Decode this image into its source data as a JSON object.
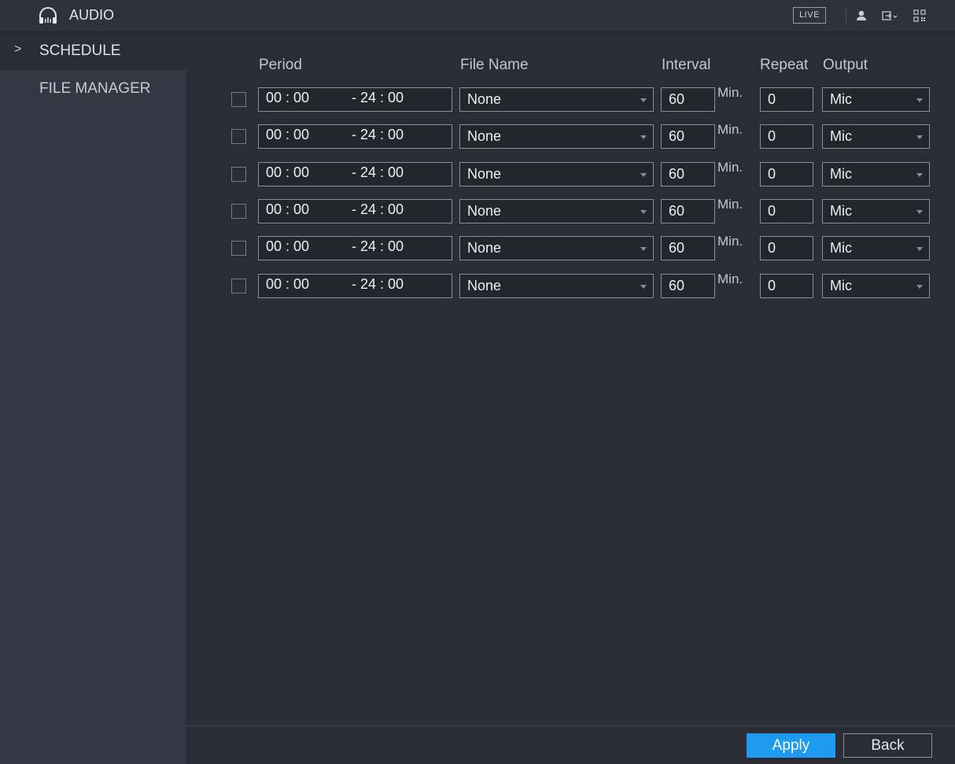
{
  "header": {
    "title": "AUDIO",
    "app_icon": "headphones-icon",
    "live_label": "LIVE",
    "icons": [
      "user-icon",
      "logout-icon",
      "qr-code-icon"
    ]
  },
  "sidebar": {
    "items": [
      {
        "label": "SCHEDULE",
        "active": true
      },
      {
        "label": "FILE MANAGER",
        "active": false
      }
    ]
  },
  "table": {
    "headers": {
      "period": "Period",
      "file_name": "File Name",
      "interval": "Interval",
      "repeat": "Repeat",
      "output": "Output"
    },
    "rows": [
      {
        "checked": false,
        "start": "00 : 00",
        "end": "- 24 : 00",
        "file": "None",
        "interval": "60",
        "unit": "Min.",
        "repeat": "0",
        "output": "Mic"
      },
      {
        "checked": false,
        "start": "00 : 00",
        "end": "- 24 : 00",
        "file": "None",
        "interval": "60",
        "unit": "Min.",
        "repeat": "0",
        "output": "Mic"
      },
      {
        "checked": false,
        "start": "00 : 00",
        "end": "- 24 : 00",
        "file": "None",
        "interval": "60",
        "unit": "Min.",
        "repeat": "0",
        "output": "Mic"
      },
      {
        "checked": false,
        "start": "00 : 00",
        "end": "- 24 : 00",
        "file": "None",
        "interval": "60",
        "unit": "Min.",
        "repeat": "0",
        "output": "Mic"
      },
      {
        "checked": false,
        "start": "00 : 00",
        "end": "- 24 : 00",
        "file": "None",
        "interval": "60",
        "unit": "Min.",
        "repeat": "0",
        "output": "Mic"
      },
      {
        "checked": false,
        "start": "00 : 00",
        "end": "- 24 : 00",
        "file": "None",
        "interval": "60",
        "unit": "Min.",
        "repeat": "0",
        "output": "Mic"
      }
    ]
  },
  "footer": {
    "apply_label": "Apply",
    "back_label": "Back"
  },
  "colors": {
    "accent": "#1e9af0",
    "background": "#2b2c35",
    "sidebar": "#363743"
  }
}
